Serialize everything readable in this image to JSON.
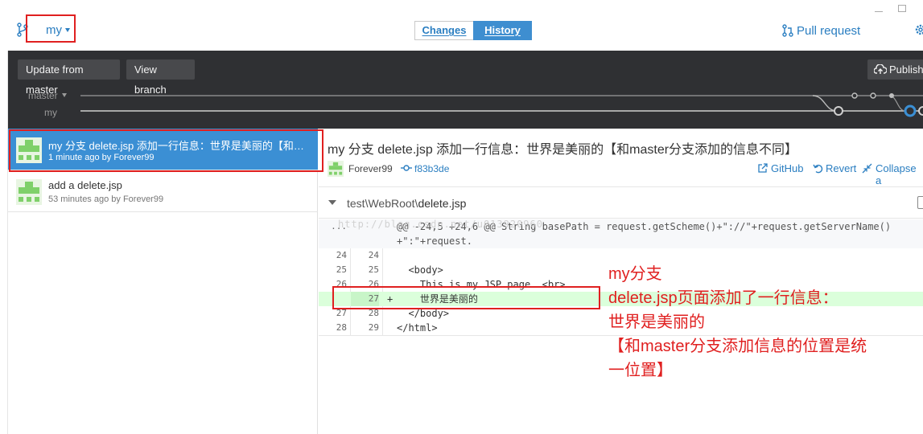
{
  "toolbar": {
    "branch_name": "my",
    "tabs": [
      {
        "label": "Changes"
      },
      {
        "label": "History"
      }
    ],
    "pull_request_label": "Pull request"
  },
  "branch_bar": {
    "update_button": "Update from master",
    "view_branch_button": "View branch",
    "publish_button": "Publish",
    "lanes": [
      "master",
      "my"
    ]
  },
  "commits": [
    {
      "title": "my  分支   delete.jsp 添加一行信息：世界是美丽的【和master分支添加的信息不同】",
      "meta": "1 minute ago by Forever99"
    },
    {
      "title": "add a delete.jsp",
      "meta": "53 minutes ago by Forever99"
    }
  ],
  "detail": {
    "title": "my  分支   delete.jsp 添加一行信息：世界是美丽的【和master分支添加的信息不同】",
    "author": "Forever99",
    "sha": "f83b3de",
    "actions": {
      "github": "GitHub",
      "revert": "Revert",
      "collapse": "Collapse a"
    }
  },
  "file": {
    "dir": "test\\WebRoot\\",
    "name": "delete.jsp"
  },
  "diff": {
    "hunk_marker": "...",
    "hunk_line1": "@@ -24,5 +24,6 @@ String basePath = request.getScheme()+\"://\"+request.getServerName()",
    "hunk_line2": "+\":\"+request.",
    "lines": [
      {
        "old": "24",
        "new": "24",
        "marker": "",
        "code": ""
      },
      {
        "old": "25",
        "new": "25",
        "marker": "",
        "code": "  <body>"
      },
      {
        "old": "26",
        "new": "26",
        "marker": "",
        "code": "    This is my JSP page. <br>"
      },
      {
        "old": "",
        "new": "27",
        "marker": "+",
        "code": "    世界是美丽的"
      },
      {
        "old": "27",
        "new": "28",
        "marker": "",
        "code": "  </body>"
      },
      {
        "old": "28",
        "new": "29",
        "marker": "",
        "code": "</html>"
      }
    ]
  },
  "watermark": "http://blog.csdn.net/u013920960",
  "annotation": {
    "lines": [
      "my分支",
      "delete.jsp页面添加了一行信息：",
      "世界是美丽的",
      "【和master分支添加信息的位置是统",
      "一位置】"
    ]
  },
  "colors": {
    "accent": "#3b8fd4",
    "annotation_red": "#e02020",
    "dark_band": "#2f3033",
    "added_line": "#dbffdb"
  }
}
